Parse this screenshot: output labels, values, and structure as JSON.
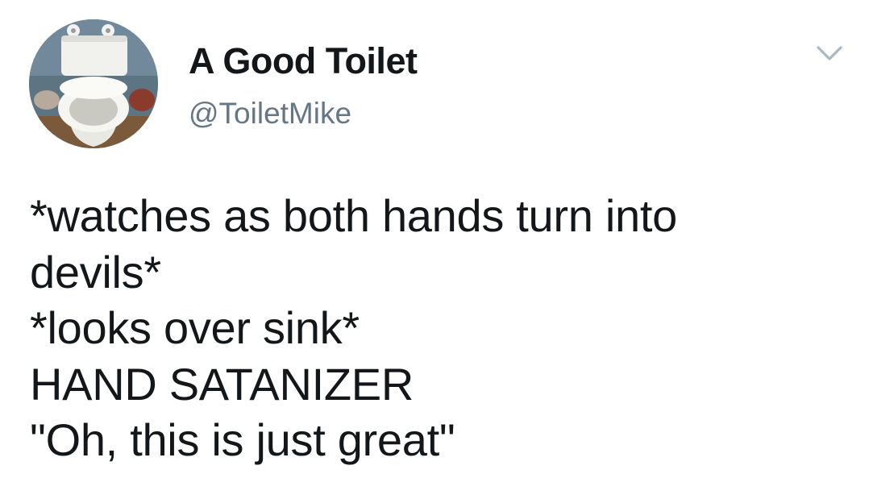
{
  "author": {
    "display_name": "A Good Toilet",
    "handle": "@ToiletMike",
    "avatar_icon": "toilet-photo-avatar"
  },
  "menu": {
    "icon": "chevron-down-icon"
  },
  "tweet": {
    "lines": [
      "*watches as both hands turn into",
      "devils*",
      "*looks over sink*",
      "HAND SATANIZER",
      "\"Oh, this is just great\""
    ]
  },
  "colors": {
    "text": "#14171a",
    "handle": "#657786",
    "chevron": "#aab8c2",
    "background": "#ffffff"
  }
}
